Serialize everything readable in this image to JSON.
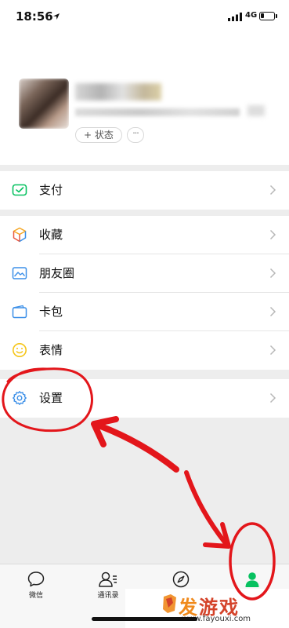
{
  "status_bar": {
    "time": "18:56",
    "network": "4G"
  },
  "profile": {
    "status_label": "+ 状态",
    "more_label": "···"
  },
  "menu": {
    "pay": "支付",
    "favorites": "收藏",
    "moments": "朋友圈",
    "cards": "卡包",
    "stickers": "表情",
    "settings": "设置"
  },
  "tabbar": {
    "chats": "微信",
    "contacts": "通讯录"
  },
  "watermark": {
    "brand_first": "发",
    "brand_rest": "游戏",
    "url": "www.fayouxi.com"
  },
  "colors": {
    "accent_green": "#07c160",
    "annotation_red": "#e3161b"
  },
  "icons": [
    "location-arrow-icon",
    "signal-icon",
    "battery-icon",
    "pay-icon",
    "favorites-icon",
    "moments-icon",
    "cards-icon",
    "stickers-icon",
    "settings-gear-icon",
    "chevron-right-icon",
    "chat-bubble-icon",
    "contacts-icon",
    "discover-compass-icon",
    "me-person-icon"
  ]
}
